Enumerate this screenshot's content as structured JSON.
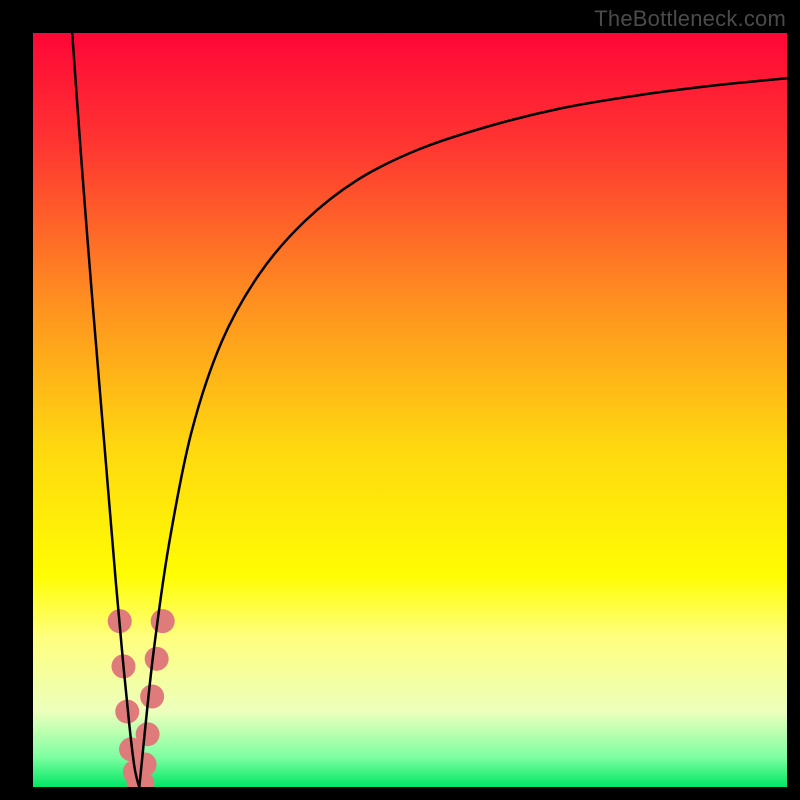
{
  "watermark": "TheBottleneck.com",
  "chart_data": {
    "type": "line",
    "title": "",
    "xlabel": "",
    "ylabel": "",
    "xlim": [
      0,
      100
    ],
    "ylim": [
      0,
      100
    ],
    "grid": false,
    "legend": false,
    "background": {
      "type": "vertical-gradient",
      "stops": [
        {
          "pos": 0.0,
          "color": "#ff0637"
        },
        {
          "pos": 0.15,
          "color": "#ff3631"
        },
        {
          "pos": 0.35,
          "color": "#ff8d21"
        },
        {
          "pos": 0.55,
          "color": "#ffd80f"
        },
        {
          "pos": 0.72,
          "color": "#fffd03"
        },
        {
          "pos": 0.8,
          "color": "#ffff7d"
        },
        {
          "pos": 0.9,
          "color": "#ecffbc"
        },
        {
          "pos": 0.96,
          "color": "#7fffa2"
        },
        {
          "pos": 1.0,
          "color": "#00e765"
        }
      ]
    },
    "series": [
      {
        "name": "bottleneck-left",
        "color": "#000000",
        "x": [
          5.2,
          6.5,
          8.0,
          9.5,
          11.0,
          12.0,
          12.8,
          13.4,
          13.8,
          14.1
        ],
        "y": [
          100,
          82,
          63,
          45,
          27,
          16,
          8,
          3,
          1,
          0
        ]
      },
      {
        "name": "bottleneck-right",
        "color": "#000000",
        "x": [
          14.1,
          14.8,
          16.0,
          18.0,
          21.0,
          25.0,
          30.0,
          36.0,
          43.0,
          51.0,
          60.0,
          70.0,
          80.0,
          90.0,
          100.0
        ],
        "y": [
          0,
          7,
          18,
          32,
          47,
          59,
          68,
          75,
          80.5,
          84.5,
          87.5,
          90,
          91.7,
          93,
          94
        ]
      }
    ],
    "scatter": {
      "name": "data-points",
      "color": "#df7b7b",
      "radius": 12,
      "points": [
        {
          "x": 11.5,
          "y": 22
        },
        {
          "x": 12.0,
          "y": 16
        },
        {
          "x": 12.5,
          "y": 10
        },
        {
          "x": 13.0,
          "y": 5
        },
        {
          "x": 13.5,
          "y": 2
        },
        {
          "x": 14.0,
          "y": 0.5
        },
        {
          "x": 14.5,
          "y": 0.5
        },
        {
          "x": 14.8,
          "y": 3
        },
        {
          "x": 15.2,
          "y": 7
        },
        {
          "x": 15.8,
          "y": 12
        },
        {
          "x": 16.4,
          "y": 17
        },
        {
          "x": 17.2,
          "y": 22
        }
      ]
    }
  }
}
